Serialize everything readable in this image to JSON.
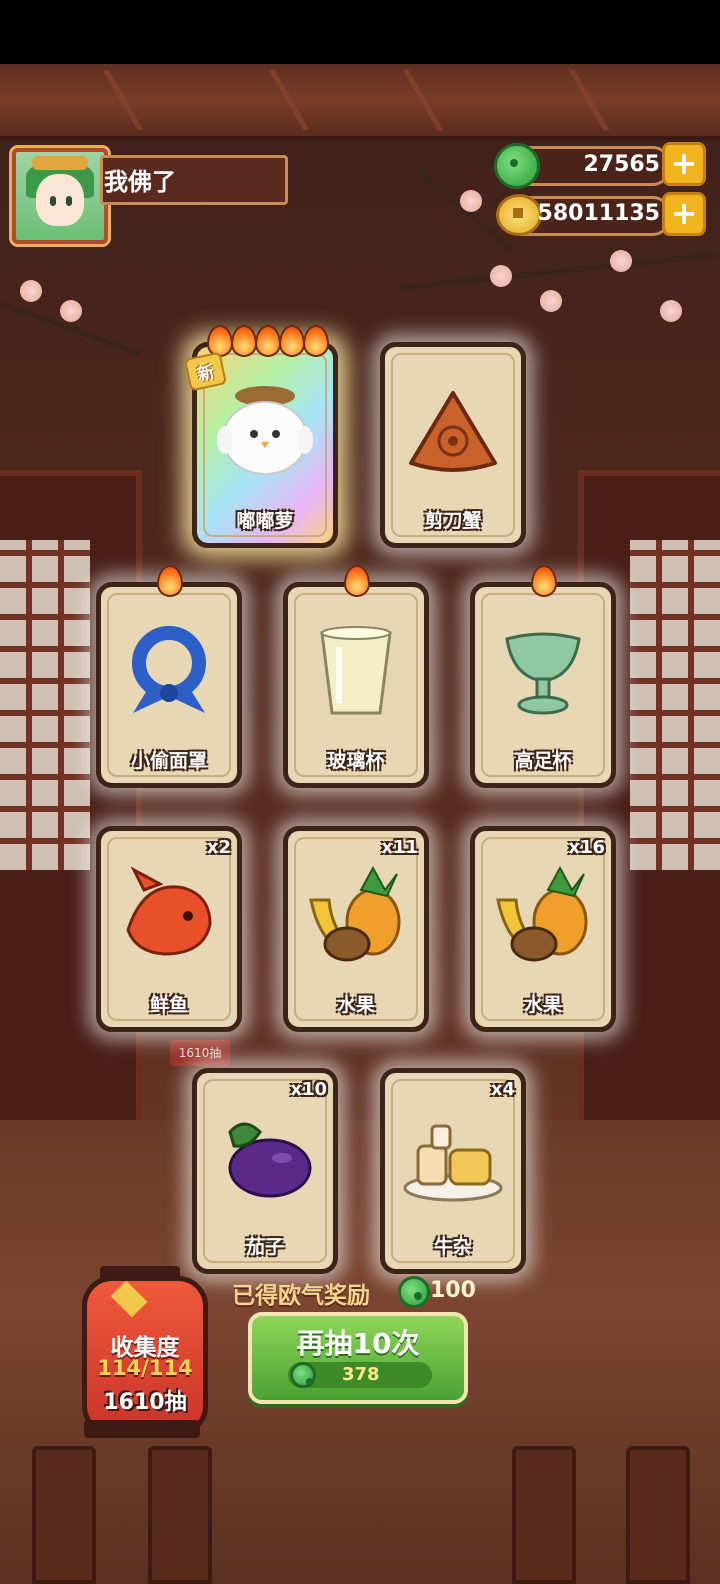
{
  "player": {
    "name": "我佛了"
  },
  "currencies": {
    "jade": {
      "value": "27565"
    },
    "coins": {
      "value": "58011135"
    }
  },
  "plus_label": "+",
  "new_badge": "新",
  "cards": [
    {
      "label": "嘟嘟萝",
      "count": "",
      "flames": 5,
      "is_new": true,
      "rarity": "rainbow",
      "icon": "fluffy-chick-icon"
    },
    {
      "label": "剪刀蟹",
      "count": "",
      "flames": 0,
      "is_new": false,
      "rarity": "normal",
      "icon": "crab-shell-icon"
    },
    {
      "label": "小偷面罩",
      "count": "",
      "flames": 1,
      "is_new": false,
      "rarity": "normal",
      "icon": "blue-bandana-icon"
    },
    {
      "label": "玻璃杯",
      "count": "",
      "flames": 1,
      "is_new": false,
      "rarity": "normal",
      "icon": "glass-cup-icon"
    },
    {
      "label": "高足杯",
      "count": "",
      "flames": 1,
      "is_new": false,
      "rarity": "normal",
      "icon": "goblet-icon"
    },
    {
      "label": "鲜鱼",
      "count": "x2",
      "flames": 0,
      "is_new": false,
      "rarity": "normal",
      "icon": "red-fish-icon"
    },
    {
      "label": "水果",
      "count": "x11",
      "flames": 0,
      "is_new": false,
      "rarity": "normal",
      "icon": "fruit-basket-icon"
    },
    {
      "label": "水果",
      "count": "x16",
      "flames": 0,
      "is_new": false,
      "rarity": "normal",
      "icon": "fruit-basket-icon"
    },
    {
      "label": "茄子",
      "count": "x10",
      "flames": 0,
      "is_new": false,
      "rarity": "normal",
      "icon": "eggplant-icon"
    },
    {
      "label": "牛杂",
      "count": "x4",
      "flames": 0,
      "is_new": false,
      "rarity": "normal",
      "icon": "beef-offal-plate-icon"
    }
  ],
  "reward": {
    "label": "已得欧气奖励",
    "value": "100"
  },
  "draw_button": {
    "label": "再抽10次",
    "cost": "378"
  },
  "collection": {
    "title": "收集度",
    "progress": "114/114",
    "draws": "1610抽"
  },
  "background_tag": "1610抽",
  "colors": {
    "jade": "#2a9b3a",
    "gold": "#f2b41e",
    "button_green": "#4aa132",
    "lantern_red": "#c9342a"
  }
}
